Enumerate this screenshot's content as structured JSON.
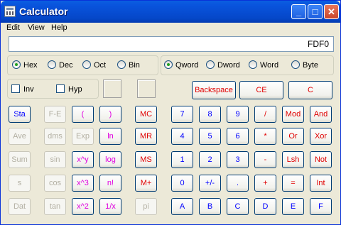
{
  "window": {
    "title": "Calculator",
    "minimize": "_",
    "maximize": "□",
    "close": "✕"
  },
  "menu": {
    "edit": "Edit",
    "view": "View",
    "help": "Help"
  },
  "display": {
    "value": "FDF0"
  },
  "base": {
    "hex": "Hex",
    "dec": "Dec",
    "oct": "Oct",
    "bin": "Bin",
    "selected": "Hex"
  },
  "word_size": {
    "qword": "Qword",
    "dword": "Dword",
    "word": "Word",
    "byte": "Byte",
    "selected": "Qword"
  },
  "options": {
    "inv": "Inv",
    "hyp": "Hyp"
  },
  "control": {
    "backspace": "Backspace",
    "ce": "CE",
    "c": "C"
  },
  "sci": {
    "sta": "Sta",
    "fe": "F-E",
    "lparen": "(",
    "rparen": ")",
    "ave": "Ave",
    "dms": "dms",
    "exp": "Exp",
    "ln": "ln",
    "sum": "Sum",
    "sin": "sin",
    "xy": "x^y",
    "log": "log",
    "s": "s",
    "cos": "cos",
    "x3": "x^3",
    "nfact": "n!",
    "dat": "Dat",
    "tan": "tan",
    "x2": "x^2",
    "recip": "1/x"
  },
  "memory": {
    "mc": "MC",
    "mr": "MR",
    "ms": "MS",
    "mplus": "M+",
    "pi": "pi"
  },
  "keys": {
    "7": "7",
    "8": "8",
    "9": "9",
    "div": "/",
    "mod": "Mod",
    "and": "And",
    "4": "4",
    "5": "5",
    "6": "6",
    "mul": "*",
    "or": "Or",
    "xor": "Xor",
    "1": "1",
    "2": "2",
    "3": "3",
    "sub": "-",
    "lsh": "Lsh",
    "not": "Not",
    "0": "0",
    "pm": "+/-",
    "dot": ".",
    "add": "+",
    "eq": "=",
    "int": "Int",
    "a": "A",
    "b": "B",
    "c": "C",
    "d": "D",
    "e": "E",
    "f": "F"
  },
  "colors": {
    "titlebar": "#0547c9",
    "face": "#ece9d8",
    "red": "#e00000",
    "blue": "#0000ff",
    "magenta": "#e000e0"
  }
}
